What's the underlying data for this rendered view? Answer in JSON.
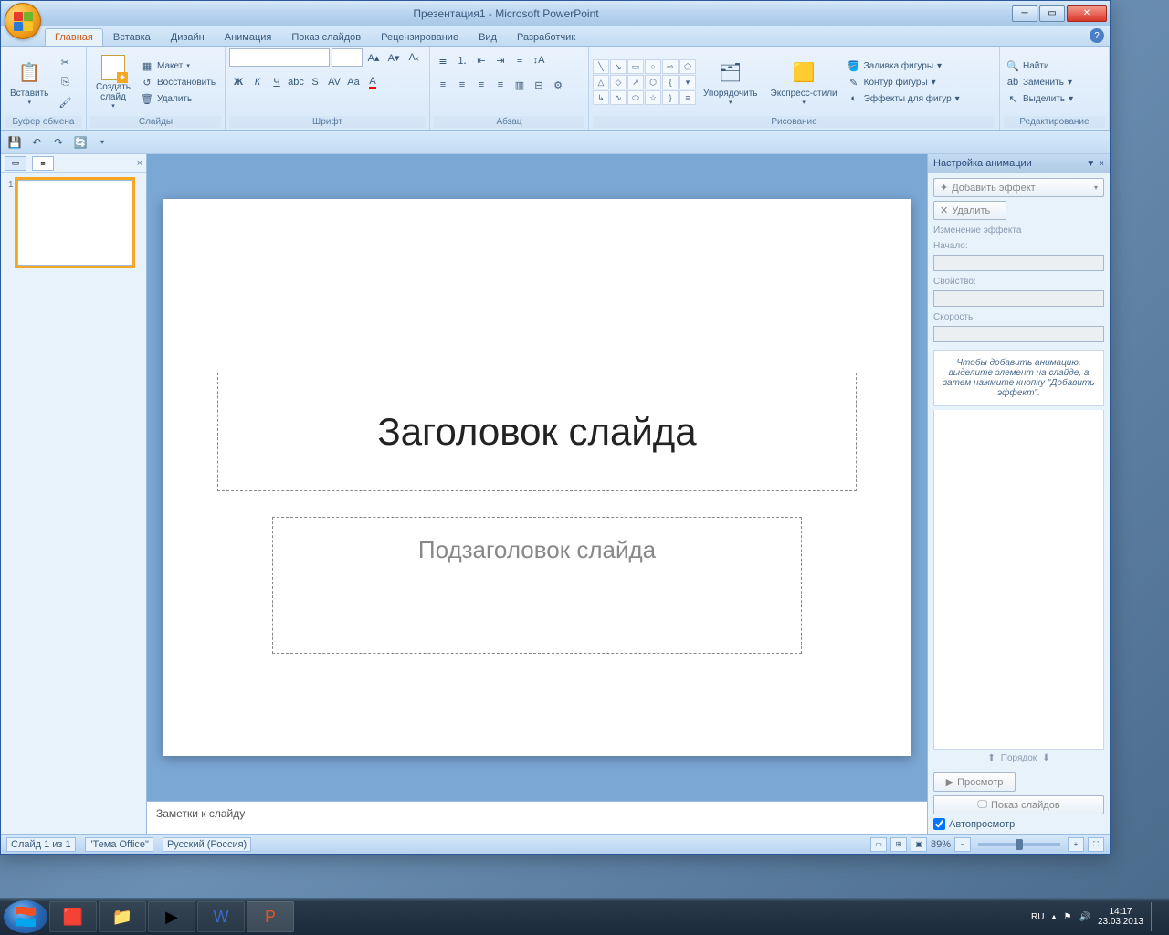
{
  "title": "Презентация1 - Microsoft PowerPoint",
  "tabs": [
    "Главная",
    "Вставка",
    "Дизайн",
    "Анимация",
    "Показ слайдов",
    "Рецензирование",
    "Вид",
    "Разработчик"
  ],
  "activeTab": 0,
  "ribbon": {
    "clipboard": {
      "label": "Буфер обмена",
      "paste": "Вставить"
    },
    "slides": {
      "label": "Слайды",
      "new": "Создать\nслайд",
      "layout": "Макет",
      "reset": "Восстановить",
      "delete": "Удалить"
    },
    "font": {
      "label": "Шрифт"
    },
    "paragraph": {
      "label": "Абзац"
    },
    "drawing": {
      "label": "Рисование",
      "arrange": "Упорядочить",
      "quick": "Экспресс-стили",
      "fill": "Заливка фигуры",
      "outline": "Контур фигуры",
      "effects": "Эффекты для фигур"
    },
    "editing": {
      "label": "Редактирование",
      "find": "Найти",
      "replace": "Заменить",
      "select": "Выделить"
    }
  },
  "slide": {
    "title_ph": "Заголовок слайда",
    "subtitle_ph": "Подзаголовок слайда",
    "notes_ph": "Заметки к слайду"
  },
  "taskpane": {
    "title": "Настройка анимации",
    "add_effect": "Добавить эффект",
    "remove": "Удалить",
    "modify": "Изменение эффекта",
    "start": "Начало:",
    "property": "Свойство:",
    "speed": "Скорость:",
    "hint": "Чтобы добавить анимацию, выделите элемент на слайде, а затем нажмите кнопку \"Добавить эффект\".",
    "order": "Порядок",
    "preview": "Просмотр",
    "slideshow": "Показ слайдов",
    "autopreview": "Автопросмотр"
  },
  "status": {
    "slide": "Слайд 1 из 1",
    "theme": "\"Тема Office\"",
    "lang": "Русский (Россия)",
    "zoom": "89%"
  },
  "tray": {
    "lang": "RU",
    "time": "14:17",
    "date": "23.03.2013"
  },
  "thumb_num": "1"
}
